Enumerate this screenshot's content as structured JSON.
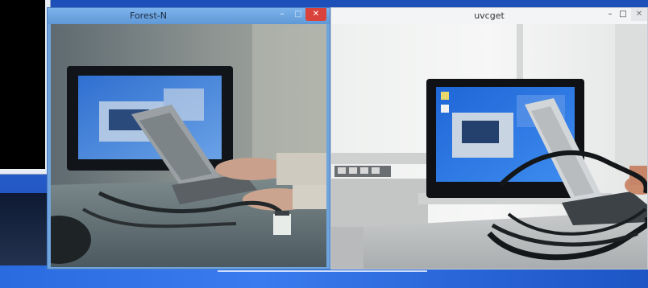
{
  "windows": {
    "forest": {
      "title": "Forest-N",
      "minimize": "–",
      "maximize": "□",
      "close": "✕"
    },
    "uvcget": {
      "title": "uvcget",
      "minimize": "–",
      "maximize": "□",
      "close": "✕"
    }
  },
  "icons": {
    "minimize": "minimize-icon",
    "maximize": "maximize-icon",
    "close": "close-icon"
  }
}
